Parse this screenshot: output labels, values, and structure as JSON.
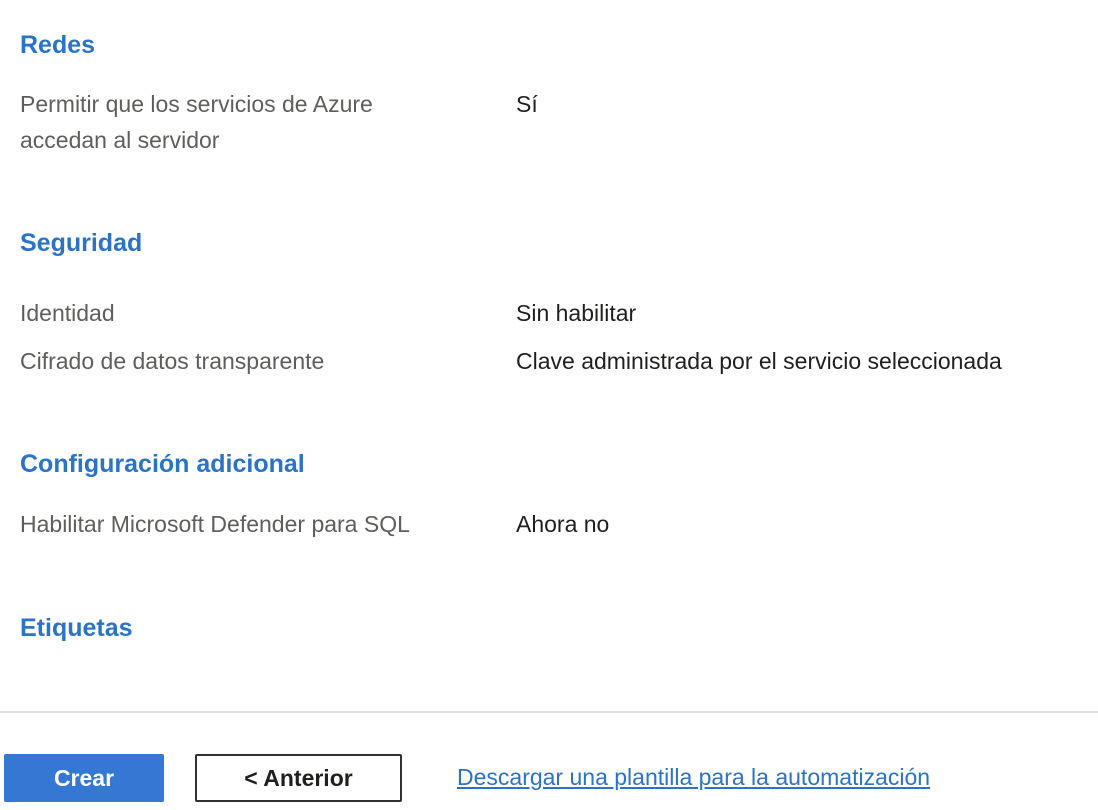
{
  "sections": {
    "networking": {
      "title": "Redes",
      "rows": [
        {
          "label": "Permitir que los servicios de Azure accedan al servidor",
          "value": "Sí"
        }
      ]
    },
    "security": {
      "title": "Seguridad",
      "rows": [
        {
          "label": "Identidad",
          "value": "Sin habilitar"
        },
        {
          "label": "Cifrado de datos transparente",
          "value": "Clave administrada por el servicio seleccionada"
        }
      ]
    },
    "additional": {
      "title": "Configuración adicional",
      "rows": [
        {
          "label": "Habilitar Microsoft Defender para SQL",
          "value": "Ahora no"
        }
      ]
    },
    "tags": {
      "title": "Etiquetas"
    }
  },
  "footer": {
    "create_label": "Crear",
    "previous_label": "< Anterior",
    "download_link": "Descargar una plantilla para la automatización"
  }
}
